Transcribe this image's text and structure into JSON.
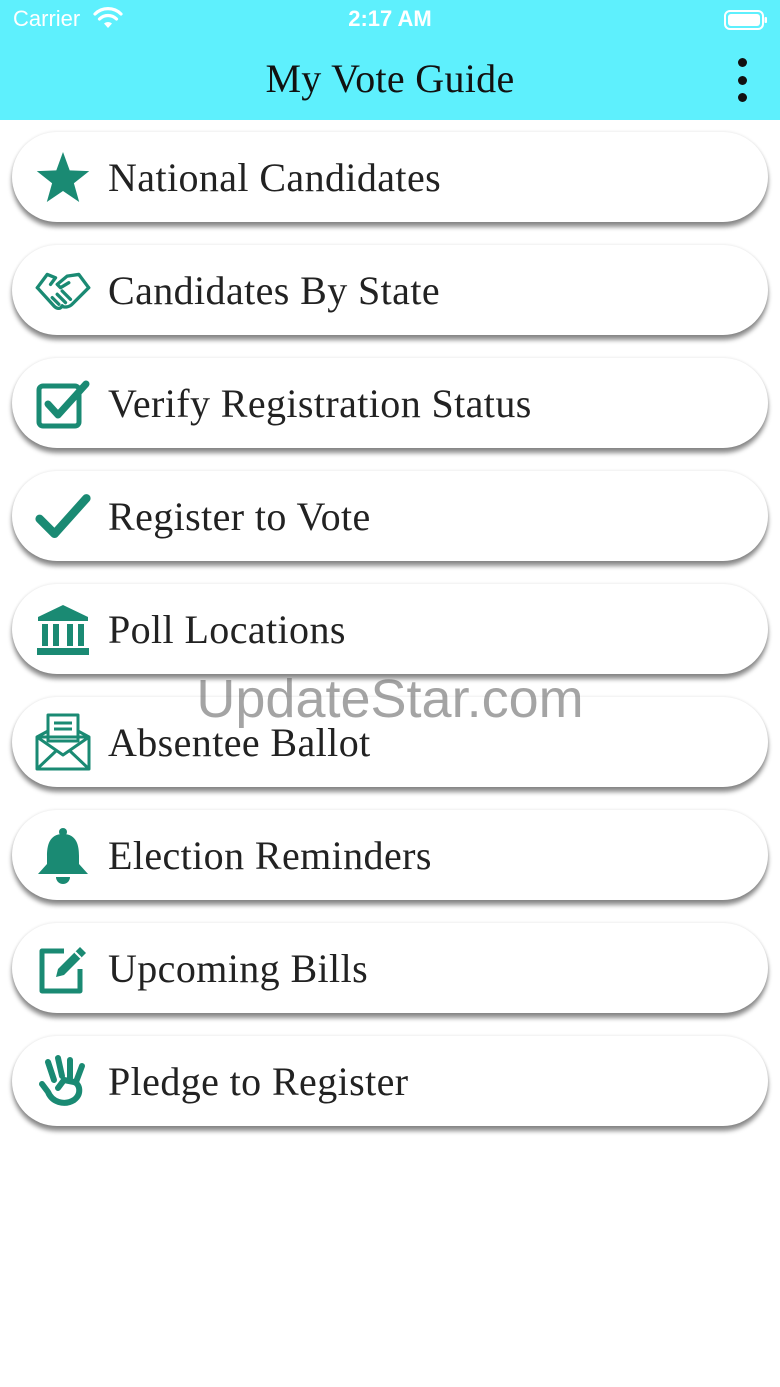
{
  "status_bar": {
    "carrier": "Carrier",
    "time": "2:17 AM",
    "wifi_icon": "wifi-icon",
    "battery_icon": "battery-icon"
  },
  "header": {
    "title": "My Vote Guide",
    "more_icon": "more-vertical-icon"
  },
  "colors": {
    "header_bg": "#5ef0fd",
    "icon_green": "#1a8a73",
    "text": "#222222"
  },
  "menu": {
    "items": [
      {
        "label": "National Candidates",
        "icon": "star-icon"
      },
      {
        "label": "Candidates By State",
        "icon": "handshake-icon"
      },
      {
        "label": "Verify Registration Status",
        "icon": "checkbox-icon"
      },
      {
        "label": "Register to Vote",
        "icon": "checkmark-icon"
      },
      {
        "label": "Poll Locations",
        "icon": "bank-icon"
      },
      {
        "label": "Absentee Ballot",
        "icon": "envelope-ballot-icon"
      },
      {
        "label": "Election Reminders",
        "icon": "bell-icon"
      },
      {
        "label": "Upcoming Bills",
        "icon": "edit-icon"
      },
      {
        "label": "Pledge to Register",
        "icon": "hand-icon"
      }
    ]
  },
  "watermark": "UpdateStar.com"
}
